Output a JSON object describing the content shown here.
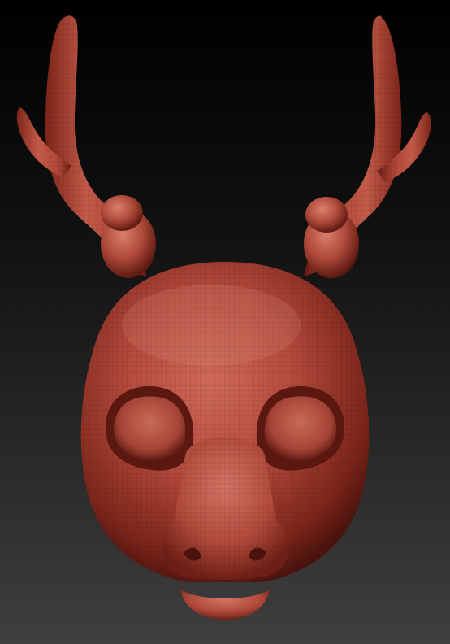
{
  "scene": {
    "subject": "deer-head-mask-sculpt",
    "material_color": "#b34a3c",
    "shadow_color": "#4a130d",
    "highlight_color": "#e09a8a",
    "background_top": "#000000",
    "background_bottom": "#3f3f3f"
  }
}
